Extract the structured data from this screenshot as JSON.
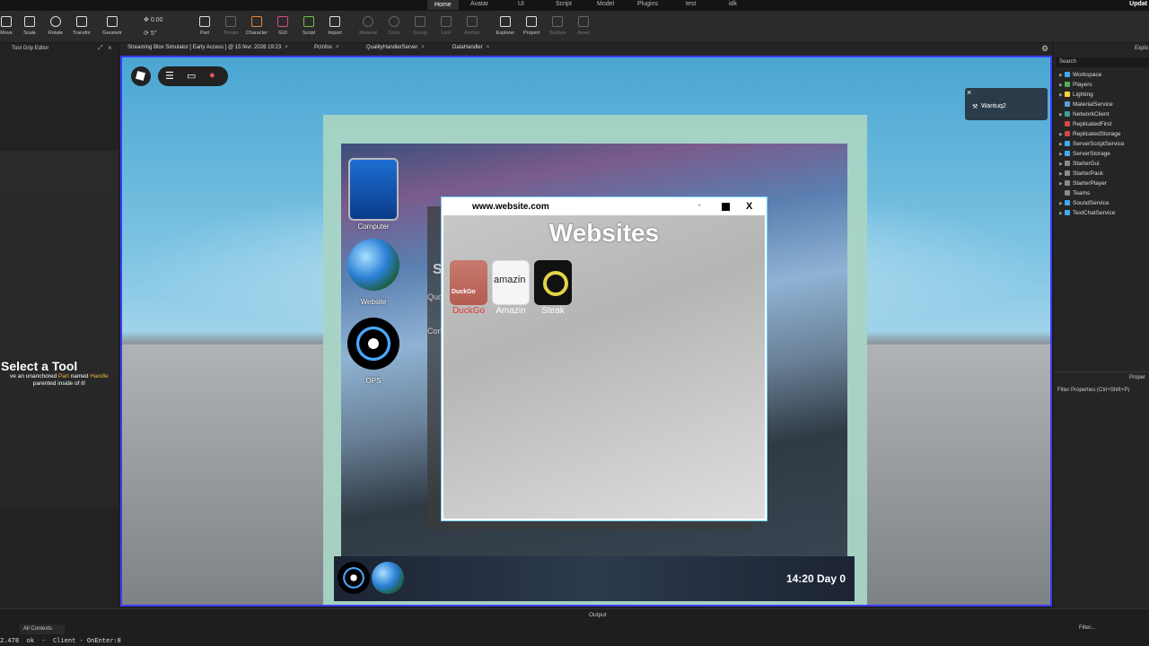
{
  "menubar": {
    "tabs": [
      "Home",
      "Avatar",
      "UI",
      "Script",
      "Model",
      "Plugins",
      "test",
      "idk"
    ],
    "active": "Home",
    "update": "Updat"
  },
  "ribbon": {
    "tools": [
      "Move",
      "Scale",
      "Rotate",
      "Transfor",
      "Geometr",
      "Part",
      "Terrain",
      "Character",
      "GUI",
      "Script",
      "Import",
      "Material",
      "Color",
      "Group",
      "Lock",
      "Anchor",
      "Explorer",
      "Propert",
      "Toolbox",
      "Asset"
    ],
    "move_value": "0.00",
    "rotate_value": "5°"
  },
  "doc_tabs": [
    "Streaming Blox Simulator [ Early Access ] @ 15 févr. 2026 19:23",
    "PcInfos",
    "QualityHandlerServer",
    "DataHandler"
  ],
  "left_panel": {
    "title": "Tool Grip Editor",
    "hint_title": "Select a Tool",
    "hint_line1_pre": "ve an unanchored ",
    "hint_part": "Part",
    "hint_named": " named ",
    "hint_handle": "Handle",
    "hint_line2": "parented inside of it!"
  },
  "desktop": {
    "icons": [
      "Computer",
      "Website",
      "OPS"
    ],
    "behind_window": {
      "s": "S",
      "quo": "Quo",
      "com": "Com"
    },
    "clock": "14:20 Day 0"
  },
  "browser": {
    "url": "www.website.com",
    "min": "-",
    "close": "X",
    "heading": "Websites",
    "sites": [
      {
        "label": "DuckGo"
      },
      {
        "label": "Amazin"
      },
      {
        "label": "Steak"
      }
    ]
  },
  "player_popup": {
    "close": "×",
    "name": "Wantuq2"
  },
  "explorer": {
    "title": "Explo",
    "search_placeholder": "Search",
    "items": [
      {
        "label": "Workspace",
        "color": "#3fa9f5"
      },
      {
        "label": "Players",
        "color": "#4fb04f"
      },
      {
        "label": "Lighting",
        "color": "#f5d33f"
      },
      {
        "label": "MaterialService",
        "color": "#5aa0d8"
      },
      {
        "label": "NetworkClient",
        "color": "#3aa0a0"
      },
      {
        "label": "ReplicatedFirst",
        "color": "#d04848"
      },
      {
        "label": "ReplicatedStorage",
        "color": "#d04848"
      },
      {
        "label": "ServerScriptService",
        "color": "#3fa9f5"
      },
      {
        "label": "ServerStorage",
        "color": "#3fa9f5"
      },
      {
        "label": "StarterGui",
        "color": "#8a8a8a"
      },
      {
        "label": "StarterPack",
        "color": "#8a8a8a"
      },
      {
        "label": "StarterPlayer",
        "color": "#8a8a8a"
      },
      {
        "label": "Teams",
        "color": "#8a8a8a"
      },
      {
        "label": "SoundService",
        "color": "#3fa9f5"
      },
      {
        "label": "TextChatService",
        "color": "#3fa9f5"
      }
    ],
    "props_title": "Proper",
    "props_filter": "Filter Properties (Ctrl+Shift+P)"
  },
  "output": {
    "title": "Output",
    "context": "All Contexts",
    "filter": "Filter...",
    "line": "2.478  ok  -  Client - OnEnter:8"
  }
}
